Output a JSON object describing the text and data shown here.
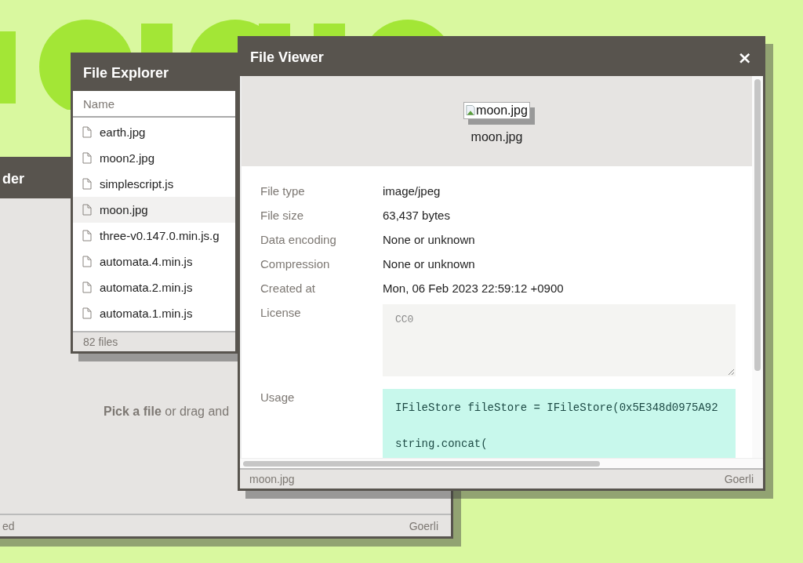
{
  "uploader_window": {
    "title": "der",
    "prompt": "**Pick a file** or drag and",
    "status_left": "ed",
    "status_right": "Goerli"
  },
  "explorer_window": {
    "title": "File Explorer",
    "column": "Name",
    "files": [
      {
        "name": "earth.jpg",
        "selected": false
      },
      {
        "name": "moon2.jpg",
        "selected": false
      },
      {
        "name": "simplescript.js",
        "selected": false
      },
      {
        "name": "moon.jpg",
        "selected": true
      },
      {
        "name": "three-v0.147.0.min.js.g",
        "selected": false
      },
      {
        "name": "automata.4.min.js",
        "selected": false
      },
      {
        "name": "automata.2.min.js",
        "selected": false
      },
      {
        "name": "automata.1.min.js",
        "selected": false
      }
    ],
    "footer": "82 files"
  },
  "viewer_window": {
    "title": "File Viewer",
    "close": "×",
    "image_alt": "moon.jpg",
    "caption": "moon.jpg",
    "properties": [
      {
        "label": "File type",
        "value": "image/jpeg"
      },
      {
        "label": "File size",
        "value": "63,437 bytes"
      },
      {
        "label": "Data encoding",
        "value": "None or unknown"
      },
      {
        "label": "Compression",
        "value": "None or unknown"
      },
      {
        "label": "Created at",
        "value": "Mon, 06 Feb 2023 22:59:12 +0900"
      }
    ],
    "license_label": "License",
    "license": "CC0",
    "usage_label": "Usage",
    "usage_lines": [
      "IFileStore fileStore = IFileStore(0x5E348d0975A92",
      "string.concat("
    ],
    "status_left": "moon.jpg",
    "status_right": "Goerli"
  }
}
